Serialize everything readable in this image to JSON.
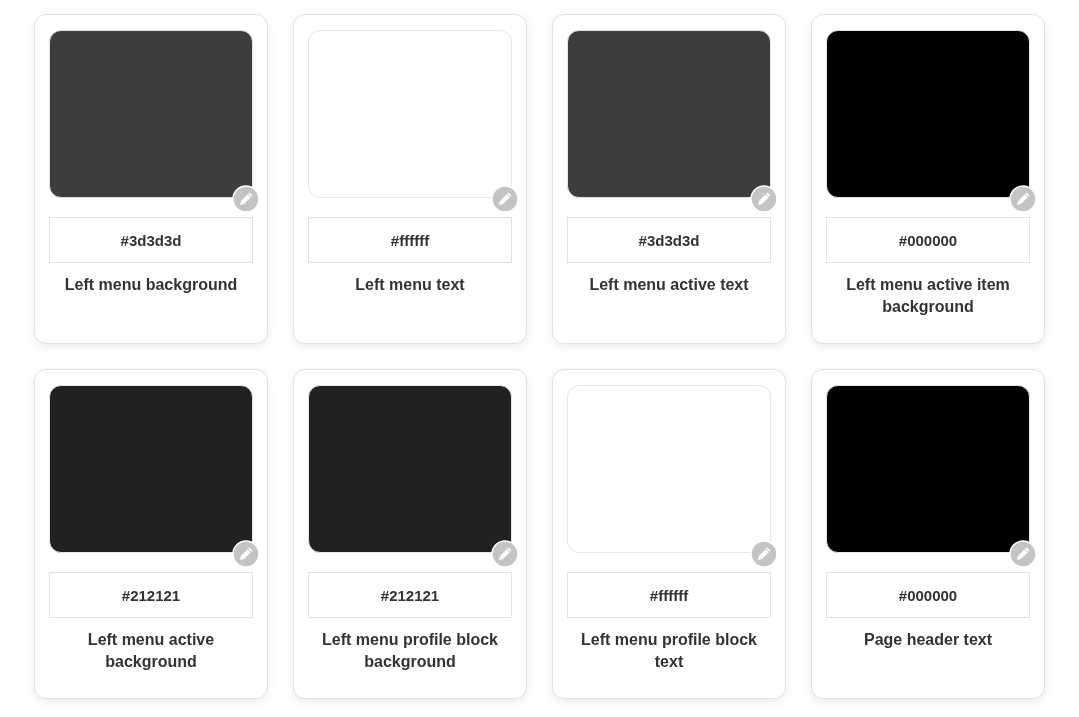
{
  "swatches": [
    {
      "color": "#3d3d3d",
      "hex": "#3d3d3d",
      "label": "Left menu background"
    },
    {
      "color": "#ffffff",
      "hex": "#ffffff",
      "label": "Left menu text"
    },
    {
      "color": "#3d3d3d",
      "hex": "#3d3d3d",
      "label": "Left menu active text"
    },
    {
      "color": "#000000",
      "hex": "#000000",
      "label": "Left menu active item background"
    },
    {
      "color": "#212121",
      "hex": "#212121",
      "label": "Left menu active background"
    },
    {
      "color": "#212121",
      "hex": "#212121",
      "label": "Left menu profile block background"
    },
    {
      "color": "#ffffff",
      "hex": "#ffffff",
      "label": "Left menu profile block text"
    },
    {
      "color": "#000000",
      "hex": "#000000",
      "label": "Page header text"
    }
  ]
}
